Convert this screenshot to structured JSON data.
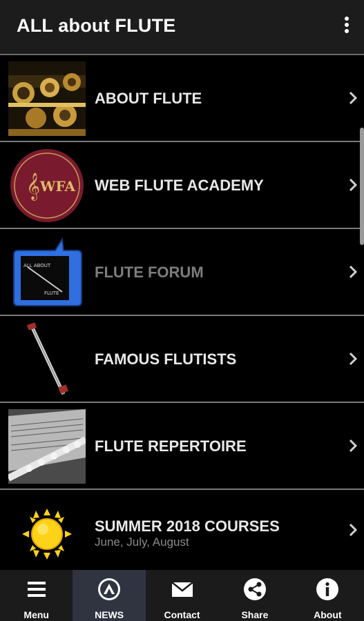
{
  "app": {
    "title": "ALL about FLUTE"
  },
  "list": {
    "items": [
      {
        "label": "ABOUT FLUTE",
        "subtitle": ""
      },
      {
        "label": "WEB FLUTE ACADEMY",
        "subtitle": "",
        "logo_text": "WFA"
      },
      {
        "label": "FLUTE FORUM",
        "subtitle": "",
        "logo_text_top": "ALL ABOUT",
        "logo_text_bottom": "FLUTE"
      },
      {
        "label": "FAMOUS FLUTISTS",
        "subtitle": ""
      },
      {
        "label": "FLUTE REPERTOIRE",
        "subtitle": ""
      },
      {
        "label": "SUMMER 2018 COURSES",
        "subtitle": "June, July, August"
      }
    ]
  },
  "bottom_nav": {
    "items": [
      {
        "label": "Menu",
        "icon": "menu-icon"
      },
      {
        "label": "NEWS",
        "icon": "news-icon"
      },
      {
        "label": "Contact",
        "icon": "mail-icon"
      },
      {
        "label": "Share",
        "icon": "share-icon"
      },
      {
        "label": "About",
        "icon": "info-icon"
      }
    ],
    "active": "NEWS"
  },
  "colors": {
    "appbar_bg": "#1c1c1c",
    "list_bg": "#000000",
    "divider": "#7a7a7a",
    "nav_bg": "#1b1b1b",
    "nav_active_bg": "#2f3440",
    "forum_blue": "#2f6fe0",
    "wfa_maroon": "#7a1a2e",
    "sun_yellow": "#ffd21a"
  }
}
